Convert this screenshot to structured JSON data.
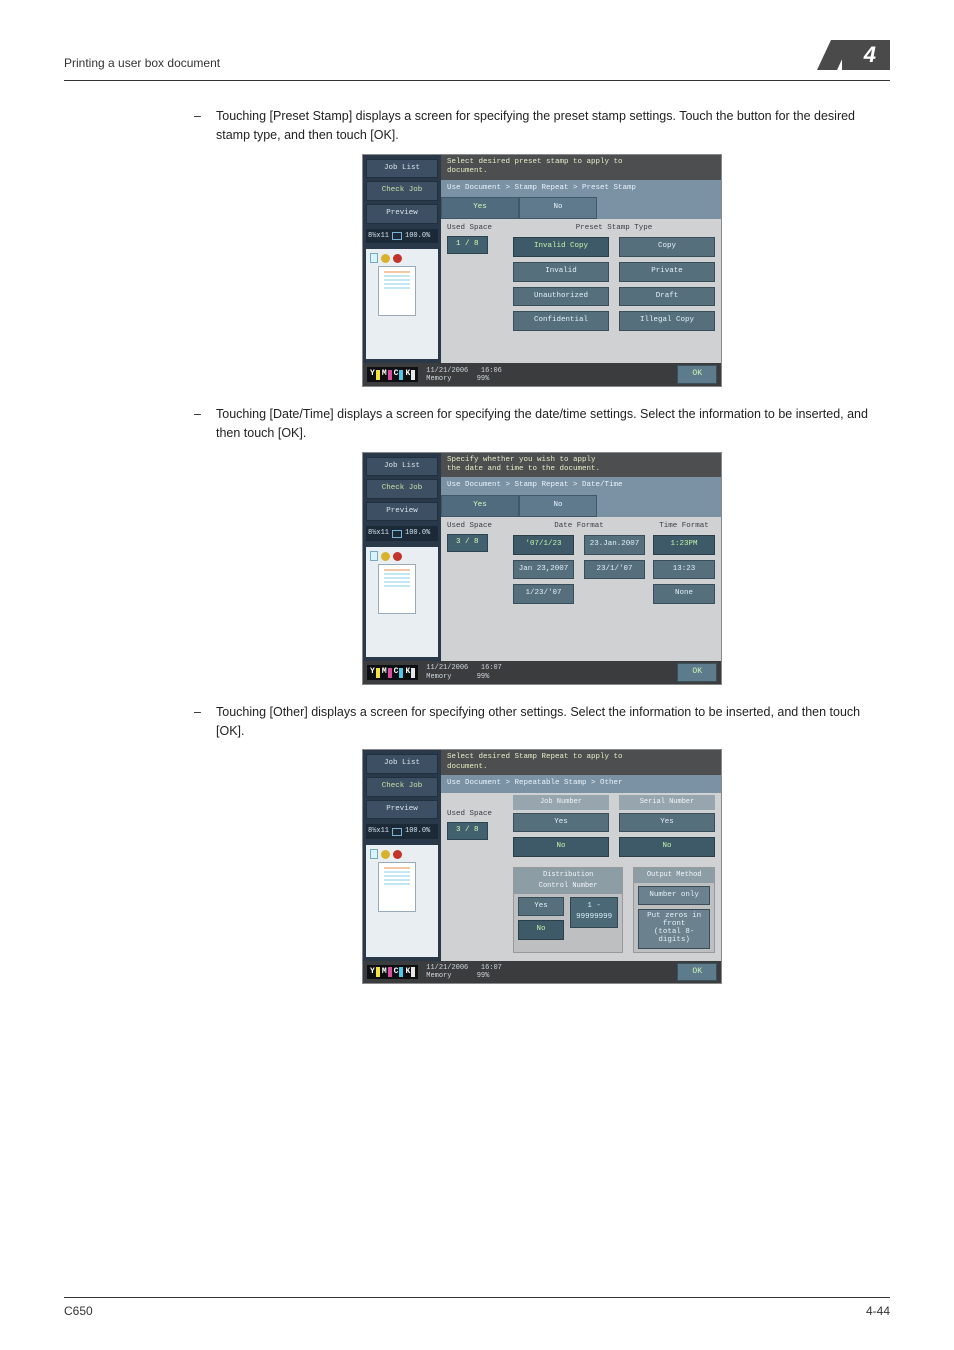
{
  "header": {
    "running_title": "Printing a user box document",
    "chapter": "4"
  },
  "bullets": {
    "b1": "Touching [Preset Stamp] displays a screen for specifying the preset stamp settings. Touch the button for the desired stamp type, and then touch [OK].",
    "b2": "Touching [Date/Time] displays a screen for specifying the date/time settings. Select the information to be inserted, and then touch [OK].",
    "b3": "Touching [Other] displays a screen for specifying other settings. Select the information to be inserted, and then touch [OK]."
  },
  "common": {
    "job_list": "Job List",
    "check_job": "Check Job",
    "preview": "Preview",
    "status_pct": "100.0%",
    "used_space": "Used Space",
    "tab_yes": "Yes",
    "tab_no": "No",
    "datetime": "11/21/2006",
    "clock": "16:06",
    "clock2": "16:07",
    "memory": "Memory",
    "mem_pct": "99%",
    "ok": "OK",
    "ymck": {
      "y": "Y",
      "m": "M",
      "c": "C",
      "k": "K"
    }
  },
  "s1": {
    "prompt": "Select desired preset stamp to apply to\ndocument.",
    "crumb": "Use Document > Stamp Repeat > Preset Stamp",
    "frac": "1  /  8",
    "section": "Preset Stamp Type",
    "opts": [
      "Invalid Copy",
      "Copy",
      "Invalid",
      "Private",
      "Unauthorized",
      "Draft",
      "Confidential",
      "Illegal Copy"
    ]
  },
  "s2": {
    "prompt": "Specify whether you wish to apply\nthe date and time to the document.",
    "crumb": "Use Document > Stamp Repeat > Date/Time",
    "frac": "3  /  8",
    "date_section": "Date Format",
    "time_section": "Time Format",
    "date_opts": [
      "'07/1/23",
      "23.Jan.2007",
      "Jan 23,2007",
      "23/1/'07",
      "1/23/'07"
    ],
    "time_opts": [
      "1:23PM",
      "13:23",
      "None"
    ]
  },
  "s3": {
    "prompt": "Select desired Stamp Repeat to apply to\ndocument.",
    "crumb": "Use Document > Repeatable Stamp > Other",
    "frac": "3  /  8",
    "job_number": "Job Number",
    "serial_number": "Serial Number",
    "yes": "Yes",
    "no": "No",
    "dist_title": "Distribution\nControl Number",
    "range": "1   -   99999999",
    "out_title": "Output Method",
    "out1": "Number only",
    "out2": "Put zeros in front\n(total 8-digits)"
  },
  "footer": {
    "left": "C650",
    "right": "4-44"
  }
}
